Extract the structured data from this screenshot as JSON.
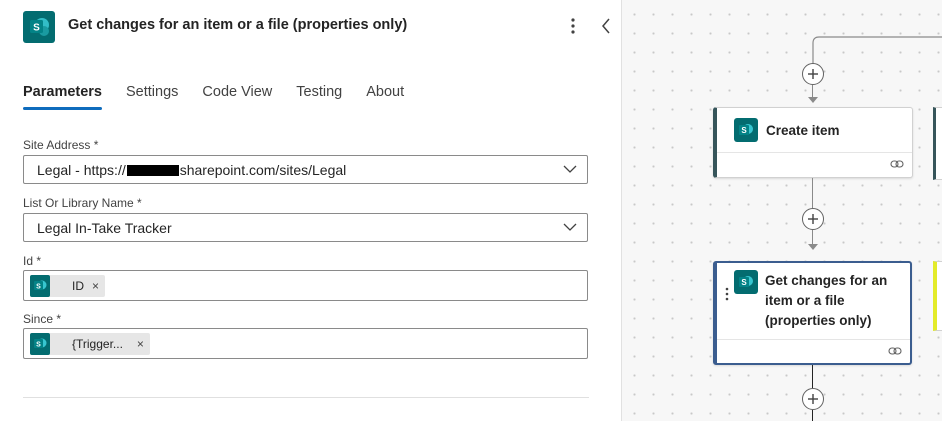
{
  "panel": {
    "title": "Get changes for an item or a file (properties only)",
    "icon": "sharepoint-icon",
    "tabs": [
      {
        "label": "Parameters",
        "active": true
      },
      {
        "label": "Settings",
        "active": false
      },
      {
        "label": "Code View",
        "active": false
      },
      {
        "label": "Testing",
        "active": false
      },
      {
        "label": "About",
        "active": false
      }
    ],
    "fields": {
      "site_address": {
        "label": "Site Address *",
        "value_prefix": "Legal - https://",
        "value_suffix": "sharepoint.com/sites/Legal"
      },
      "list_name": {
        "label": "List Or Library Name *",
        "value": "Legal In-Take Tracker"
      },
      "id": {
        "label": "Id *",
        "token": "ID",
        "token_remove": "×"
      },
      "since": {
        "label": "Since *",
        "token": "{Trigger...",
        "token_remove": "×"
      }
    }
  },
  "canvas": {
    "cards": [
      {
        "title": "Create item"
      },
      {
        "title": "Get changes for an item or a file (properties only)"
      }
    ]
  },
  "colors": {
    "sharepoint": "#036c70",
    "accent": "#0f6cbd",
    "selected_card_border": "#3b5d8f",
    "side_card_accent": "#e3eb2a"
  }
}
